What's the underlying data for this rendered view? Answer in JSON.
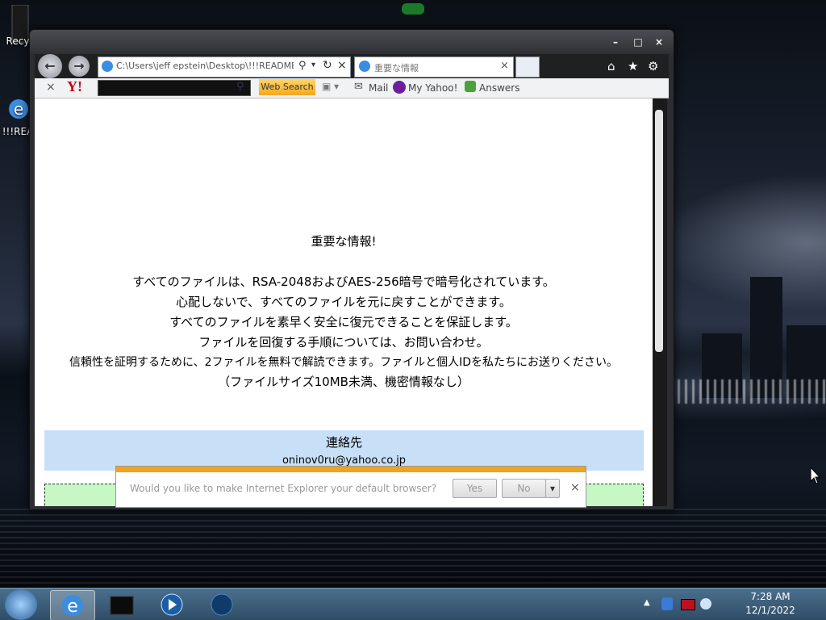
{
  "desktop": {
    "icons": [
      {
        "label": "Recy"
      },
      {
        "label": "!!!REA"
      }
    ]
  },
  "browser": {
    "address_url": "C:\\Users\\jeff epstein\\Desktop\\!!!README!",
    "tab_title": "重要な情報",
    "toolbar_icons": [
      "home-icon",
      "star-icon",
      "gear-icon"
    ],
    "yahoo_bar": {
      "close": "×",
      "search_button": "Web Search",
      "mail": "Mail",
      "my_yahoo": "My Yahoo!",
      "answers": "Answers"
    }
  },
  "page": {
    "heading": "重要な情報!",
    "lines": [
      "すべてのファイルは、RSA-2048およびAES-256暗号で暗号化されています。",
      "心配しないで、すべてのファイルを元に戻すことができます。",
      "すべてのファイルを素早く安全に復元できることを保証します。",
      "ファイルを回復する手順については、お問い合わせ。",
      "信頼性を証明するために、2ファイルを無料で解読できます。ファイルと個人IDを私たちにお送りください。",
      "（ファイルサイズ10MB未満、機密情報なし）"
    ],
    "contact_title": "連絡先",
    "contact_email": "oninov0ru@yahoo.co.jp"
  },
  "notification": {
    "message": "Would you like to make Internet Explorer your default browser?",
    "yes": "Yes",
    "no": "No",
    "close": "×"
  },
  "taskbar": {
    "time": "7:28 AM",
    "date": "12/1/2022"
  },
  "colors": {
    "accent_notification": "#f3a21b",
    "contact_box": "#c7e0f7",
    "id_box": "#c6f7c5"
  }
}
